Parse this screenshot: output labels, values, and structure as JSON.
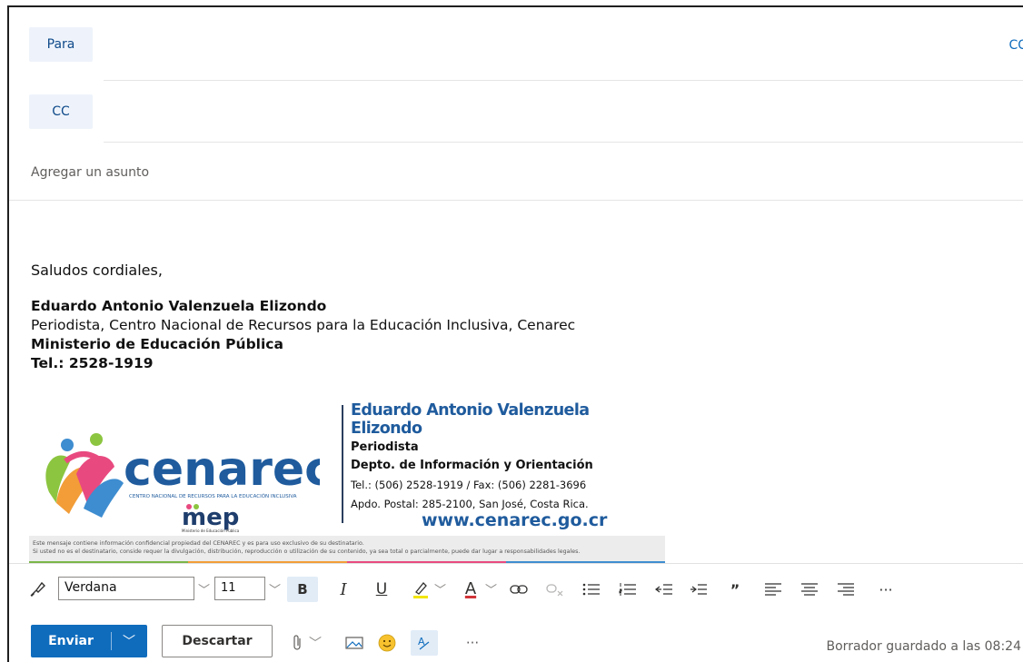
{
  "compose": {
    "to_label": "Para",
    "cc_label": "CC",
    "cc_toggle": "CC",
    "subject_placeholder": "Agregar un asunto"
  },
  "body": {
    "greeting": "Saludos cordiales,",
    "sig_name": "Eduardo Antonio Valenzuela Elizondo",
    "sig_role": "Periodista, Centro Nacional de Recursos para la Educación Inclusiva, Cenarec",
    "sig_org": "Ministerio de Educación Pública",
    "sig_tel": "Tel.: 2528-1919"
  },
  "card": {
    "logo_text": "cenarec",
    "logo_sub": "CENTRO NACIONAL DE RECURSOS PARA LA EDUCACIÓN INCLUSIVA",
    "mep_text": "mep",
    "mep_sub": "Ministerio de Educación Pública",
    "name": "Eduardo Antonio Valenzuela Elizondo",
    "role": "Periodista",
    "dept": "Depto. de Información y Orientación",
    "tel": "Tel.: (506) 2528-1919 / Fax: (506) 2281-3696",
    "addr": "Apdo. Postal: 285-2100, San José, Costa Rica.",
    "web": "www.cenarec.go.cr",
    "disclaimer_1": "Este mensaje contiene información confidencial propiedad del CENAREC y es para uso exclusivo de su destinatario.",
    "disclaimer_2": "Si usted no es el destinatario, conside requer la divulgación, distribución, reproducción o utilización de su contenido, ya sea total o parcialmente, puede dar lugar a responsabilidades legales."
  },
  "format": {
    "font": "Verdana",
    "size": "11",
    "bold": "B",
    "italic": "I",
    "underline": "U",
    "quote": "”",
    "more": "···"
  },
  "actions": {
    "send_label": "Enviar",
    "discard_label": "Descartar",
    "more": "···",
    "status": "Borrador guardado a las 08:24"
  }
}
